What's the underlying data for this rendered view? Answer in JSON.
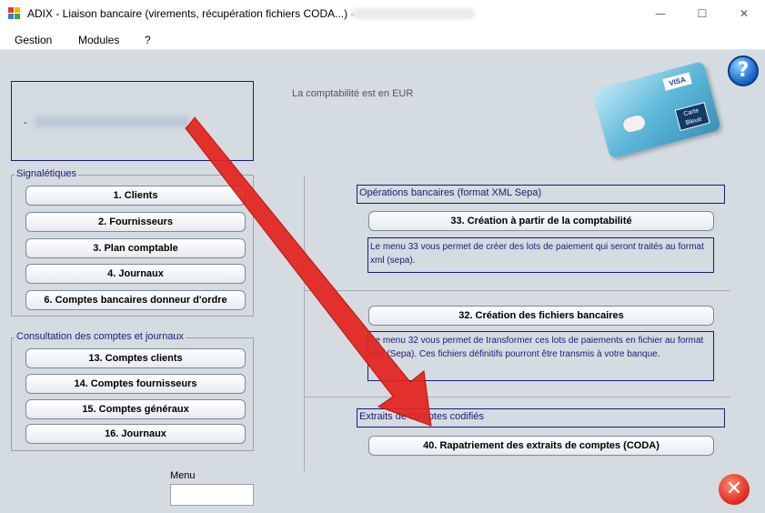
{
  "window": {
    "title": "ADIX - Liaison bancaire (virements, récupération fichiers CODA...) -",
    "minimize_glyph": "—",
    "maximize_glyph": "☐",
    "close_glyph": "✕"
  },
  "menubar": {
    "items": [
      "Gestion",
      "Modules",
      "?"
    ]
  },
  "company": {
    "dash": "-"
  },
  "currency_text": "La comptabilité est en EUR",
  "help": {
    "glyph": "?"
  },
  "card": {
    "brand": "VISA",
    "cb_line1": "Carte",
    "cb_line2": "Bleue"
  },
  "signaletiques": {
    "title": "Signalétiques",
    "buttons": [
      "1. Clients",
      "2. Fournisseurs",
      "3. Plan comptable",
      "4. Journaux",
      "6. Comptes bancaires donneur d'ordre"
    ]
  },
  "consultation": {
    "title": "Consultation des comptes et journaux",
    "buttons": [
      "13. Comptes clients",
      "14. Comptes fournisseurs",
      "15. Comptes généraux",
      "16. Journaux"
    ]
  },
  "operations": {
    "title": "Opérations bancaires (format XML Sepa)",
    "btn33": "33. Création à partir de la comptabilité",
    "desc33": "Le menu 33 vous permet de créer des lots de paiement qui seront traités au format xml (sepa).",
    "btn32": "32. Création des fichiers bancaires",
    "desc32": "Le menu 32 vous permet de transformer ces lots de paiements en fichier au format xml (Sepa). Ces fichiers définitifs pourront être transmis à votre banque."
  },
  "extraits": {
    "title": "Extraits de comptes codifiés",
    "btn40": "40. Rapatriement des extraits de comptes (CODA)"
  },
  "menu_field": {
    "label": "Menu",
    "value": ""
  },
  "close_button": {
    "glyph": "✕"
  },
  "annotation": {
    "arrow_color": "#e3231c"
  }
}
